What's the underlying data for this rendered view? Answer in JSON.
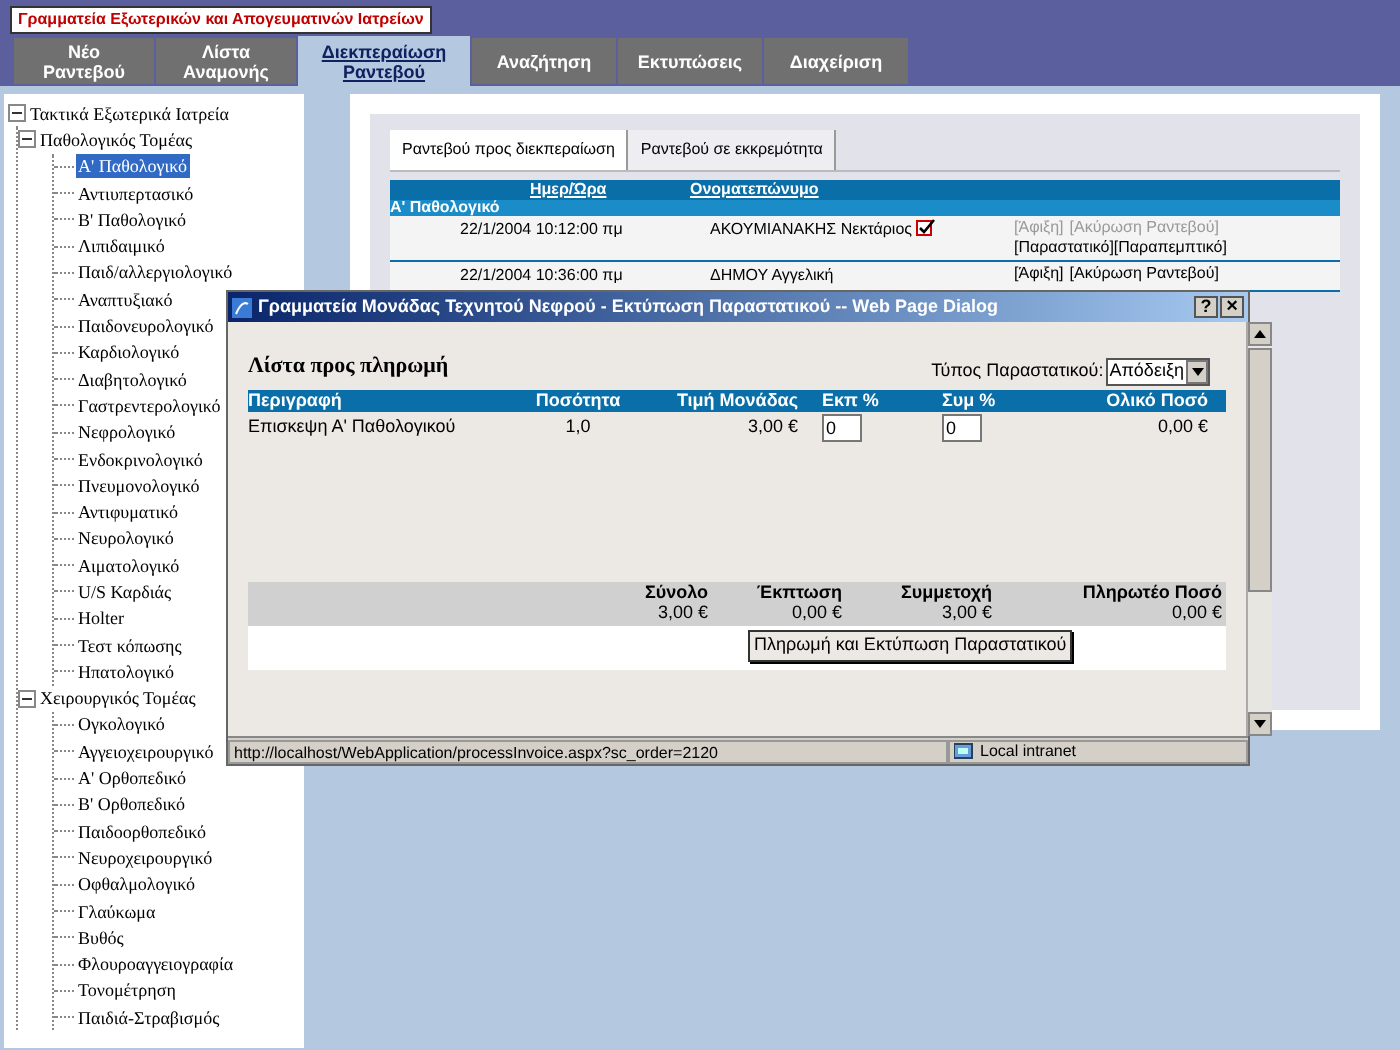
{
  "header_title": "Γραμματεία Εξωτερικών και Απογευματινών Ιατρείων",
  "tabs": [
    {
      "label": "Νέο Ραντεβού",
      "selected": false
    },
    {
      "label": "Λίστα Αναμονής",
      "selected": false
    },
    {
      "label": "Διεκπεραίωση Ραντεβού",
      "selected": true
    },
    {
      "label": "Αναζήτηση",
      "selected": false
    },
    {
      "label": "Εκτυπώσεις",
      "selected": false
    },
    {
      "label": "Διαχείριση",
      "selected": false
    }
  ],
  "tree": [
    {
      "label": "Τακτικά Εξωτερικά Ιατρεία",
      "expanded": true,
      "selected": false,
      "children": [
        {
          "label": "Παθολογικός Τομέας",
          "expanded": true,
          "selected": false,
          "children": [
            {
              "label": "Α' Παθολογικό",
              "selected": true
            },
            {
              "label": "Αντιυπερτασικό",
              "selected": false
            },
            {
              "label": "Β' Παθολογικό",
              "selected": false
            },
            {
              "label": "Λιπιδαιμικό",
              "selected": false
            },
            {
              "label": "Παιδ/αλλεργιολογικό",
              "selected": false
            },
            {
              "label": "Αναπτυξιακό",
              "selected": false
            },
            {
              "label": "Παιδονευρολογικό",
              "selected": false
            },
            {
              "label": "Καρδιολογικό",
              "selected": false
            },
            {
              "label": "Διαβητολογικό",
              "selected": false
            },
            {
              "label": "Γαστρεντερολογικό",
              "selected": false
            },
            {
              "label": "Νεφρολογικό",
              "selected": false
            },
            {
              "label": "Ενδοκρινολογικό",
              "selected": false
            },
            {
              "label": "Πνευμονολογικό",
              "selected": false
            },
            {
              "label": "Αντιφυματικό",
              "selected": false
            },
            {
              "label": "Νευρολογικό",
              "selected": false
            },
            {
              "label": "Αιματολογικό",
              "selected": false
            },
            {
              "label": "U/S Καρδιάς",
              "selected": false
            },
            {
              "label": "Holter",
              "selected": false
            },
            {
              "label": "Τεστ κόπωσης",
              "selected": false
            },
            {
              "label": "Ηπατολογικό",
              "selected": false
            }
          ]
        },
        {
          "label": "Χειρουργικός Τομέας",
          "expanded": true,
          "selected": false,
          "children": [
            {
              "label": "Ογκολογικό",
              "selected": false
            },
            {
              "label": "Αγγειοχειρουργικό",
              "selected": false
            },
            {
              "label": "Α' Ορθοπεδικό",
              "selected": false
            },
            {
              "label": "Β' Ορθοπεδικό",
              "selected": false
            },
            {
              "label": "Παιδοορθοπεδικό",
              "selected": false
            },
            {
              "label": "Νευροχειρουργικό",
              "selected": false
            },
            {
              "label": "Οφθαλμολογικό",
              "selected": false
            },
            {
              "label": "Γλαύκωμα",
              "selected": false
            },
            {
              "label": "Βυθός",
              "selected": false
            },
            {
              "label": "Φλουροαγγειογραφία",
              "selected": false
            },
            {
              "label": "Τονομέτρηση",
              "selected": false
            },
            {
              "label": "Παιδιά-Στραβισμός",
              "selected": false
            }
          ]
        }
      ]
    }
  ],
  "subtabs": [
    {
      "label": "Ραντεβού προς διεκπεραίωση",
      "selected": true
    },
    {
      "label": "Ραντεβού σε εκκρεμότητα",
      "selected": false
    }
  ],
  "appointments": {
    "columns": [
      "Ημερ/Ώρα",
      "Ονοματεπώνυμο"
    ],
    "group": "Α' Παθολογικό",
    "rows": [
      {
        "datetime": "22/1/2004 10:12:00 πμ",
        "name": "ΑΚΟΥΜΙΑΝΑΚΗΣ  Νεκτάριος",
        "checked": true,
        "actions": [
          {
            "label": "[Άφιξη]",
            "disabled": true
          },
          {
            "label": "[Ακύρωση Ραντεβού]",
            "disabled": true
          },
          {
            "label": "[Παραστατικό]",
            "disabled": false
          },
          {
            "label": "[Παραπεμπτικό]",
            "disabled": false
          }
        ]
      },
      {
        "datetime": "22/1/2004 10:36:00 πμ",
        "name": "ΔΗΜΟΥ  Αγγελική",
        "checked": false,
        "actions": [
          {
            "label": "[Άφιξη]",
            "disabled": false
          },
          {
            "label": "[Ακύρωση Ραντεβού]",
            "disabled": false
          }
        ]
      }
    ]
  },
  "dialog": {
    "title": "Γραμματεία Μονάδας Τεχνητού Νεφρού - Εκτύπωση Παραστατικού -- Web Page Dialog",
    "help": "?",
    "close": "×",
    "heading": "Λίστα προς πληρωμή",
    "type_label": "Τύπος Παραστατικού:",
    "type_value": "Απόδειξη",
    "columns": [
      "Περιγραφή",
      "Ποσότητα",
      "Τιμή Μονάδας",
      "Εκπ %",
      "Συμ %",
      "Ολικό Ποσό"
    ],
    "items": [
      {
        "description": "Επισκεψη Α' Παθολογικού",
        "quantity": "1,0",
        "unit_price": "3,00 €",
        "discount": "0",
        "contribution": "0",
        "total": "0,00 €"
      }
    ],
    "totals": [
      {
        "label": "Σύνολο",
        "value": "3,00 €"
      },
      {
        "label": "Έκπτωση",
        "value": "0,00 €"
      },
      {
        "label": "Συμμετοχή",
        "value": "3,00 €"
      },
      {
        "label": "Πληρωτέο Ποσό",
        "value": "0,00 €"
      }
    ],
    "button": "Πληρωμή και Εκτύπωση Παραστατικού",
    "status_url": "http://localhost/WebApplication/processInvoice.aspx?sc_order=2120",
    "zone": "Local intranet"
  }
}
